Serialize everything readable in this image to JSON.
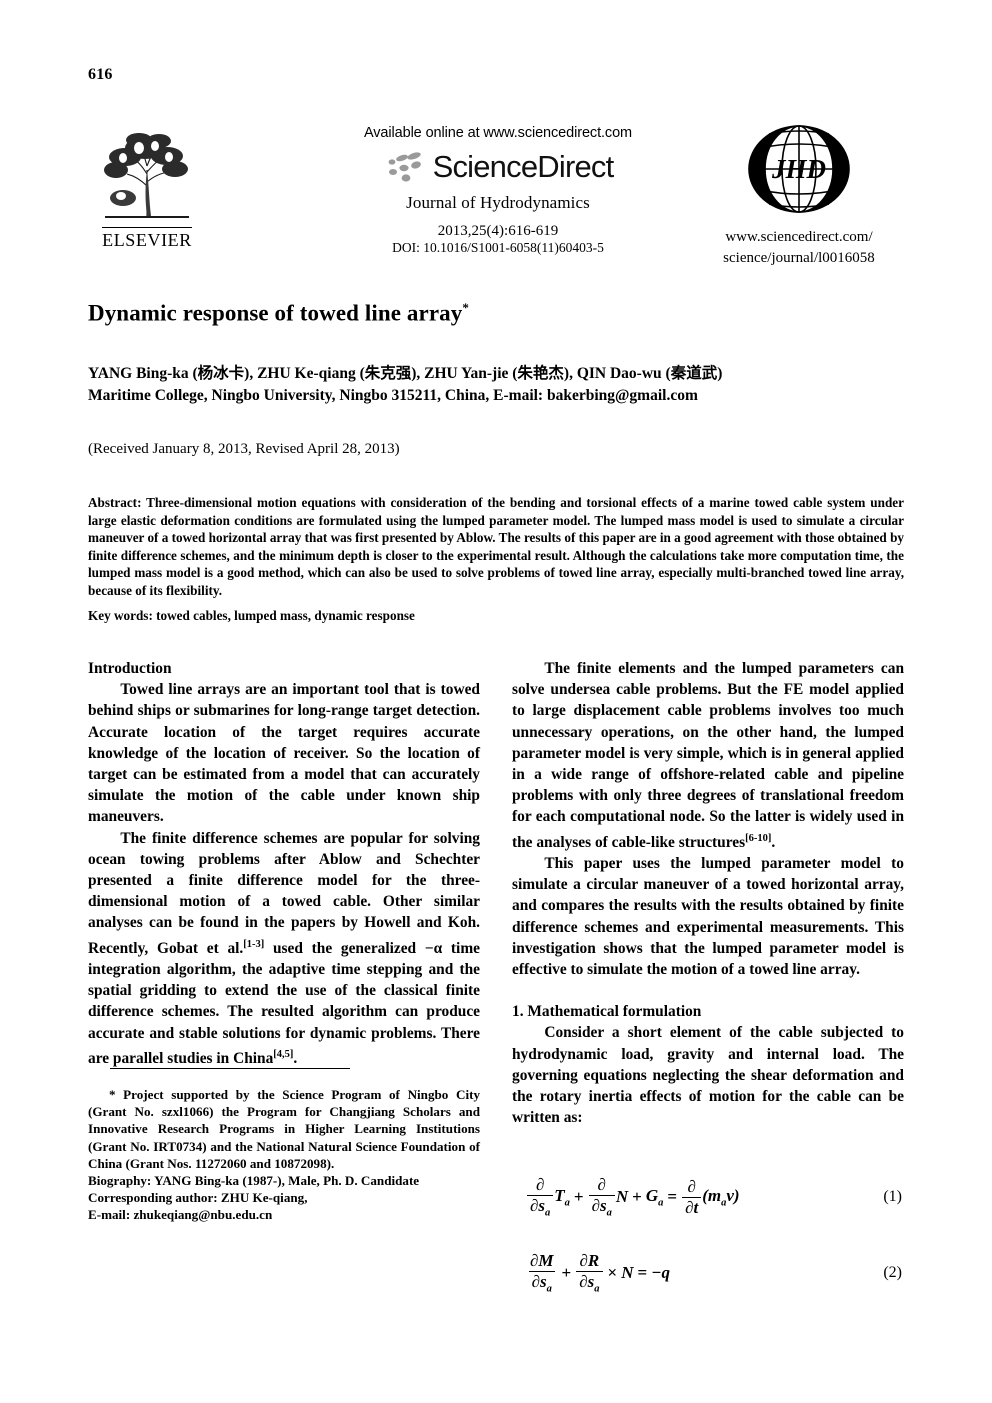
{
  "page": {
    "folio": "616"
  },
  "masthead": {
    "elsevier_label": "ELSEVIER",
    "available_online": "Available online at www.sciencedirect.com",
    "sciencedirect_wordmark": "ScienceDirect",
    "journal_name": "Journal of Hydrodynamics",
    "citation": "2013,25(4):616-619",
    "doi": "DOI: 10.1016/S1001-6058(11)60403-5",
    "jhd_monogram": "JHD",
    "jhd_url_line1": "www.sciencedirect.com/",
    "jhd_url_line2": "science/journal/l0016058"
  },
  "article": {
    "title": "Dynamic response of towed line array",
    "title_footnote_marker": "*",
    "authors": "YANG Bing-ka (杨冰卡), ZHU Ke-qiang (朱克强), ZHU Yan-jie (朱艳杰), QIN Dao-wu (秦道武)",
    "affiliation": "Maritime College, Ningbo University, Ningbo 315211, China, E-mail: bakerbing@gmail.com",
    "received": "(Received January 8, 2013, Revised April 28, 2013)"
  },
  "abstract": {
    "lead": "Abstract:",
    "text": " Three-dimensional motion equations with consideration of the bending and torsional effects of a marine towed cable system under large elastic deformation conditions are formulated using the lumped parameter model. The lumped mass model is used to simulate a circular maneuver of a towed horizontal array that was first presented by Ablow. The results of this paper are in a good agreement with those obtained by finite difference schemes, and the minimum depth is closer to the experimental result. Although the calculations take more computation time, the lumped mass model is a good method, which can also be used to solve problems of towed line array, especially multi-branched towed line array, because of its flexibility."
  },
  "keywords": {
    "lead": "Key words:",
    "text": " towed cables, lumped mass, dynamic response"
  },
  "body": {
    "left": {
      "intro_heading": "Introduction",
      "para1": "Towed line arrays are an important tool that is towed behind ships or submarines for long-range target detection. Accurate location of the target requires accurate knowledge of the location of receiver. So the location of target can be estimated from a model that can accurately simulate the motion of the cable under known ship maneuvers.",
      "para2_a": "The finite difference schemes are popular for solving ocean towing problems after Ablow and Schechter presented a finite difference model for the three-dimensional motion of a towed cable. Other similar analyses can be found in the papers by Howell and Koh. Recently, Gobat et al.",
      "para2_cite1": "[1-3]",
      "para2_b": " used the generalized −α time integration algorithm, the adaptive time stepping and the spatial gridding to extend the use of the classical finite difference schemes. The resulted algorithm can produce accurate and stable solutions for dynamic problems. There are parallel studies in China",
      "para2_cite2": "[4,5]",
      "para2_c": "."
    },
    "right": {
      "para1_a": "The finite elements and the lumped parameters can solve undersea cable problems. But the FE model applied to large displacement cable problems involves too much unnecessary operations, on the other hand, the lumped parameter model is very simple, which is in general applied in a wide range of offshore-related cable and pipeline problems with only three degrees of translational freedom for each computational node. So the latter is widely used in the analyses of cable-like structures",
      "para1_cite": "[6-10]",
      "para1_b": ".",
      "para2": "This paper uses the lumped parameter model to simulate a circular maneuver of a towed horizontal array, and compares the results with the results obtained by finite difference schemes and experimental measurements. This investigation shows that the lumped parameter model is effective to simulate the motion of a towed line array.",
      "section1_heading": "1. Mathematical formulation",
      "section1_para": "Consider a short element of the cable subjected to hydrodynamic load, gravity and internal load. The governing equations neglecting the shear deformation and the rotary inertia effects of motion for the cable can be written as:"
    }
  },
  "equations": [
    {
      "number": "(1)",
      "latex": "\\frac{\\partial}{\\partial s_a}T_a + \\frac{\\partial}{\\partial s_a}N + G_a = \\frac{\\partial}{\\partial t}(m_a v)"
    },
    {
      "number": "(2)",
      "latex": "\\frac{\\partial M}{\\partial s_a} + \\frac{\\partial R}{\\partial s_a} \\times N = -q"
    }
  ],
  "footnote": {
    "star_text": "* Project supported by the Science Program of Ningbo City (Grant No. szxl1066) the Program for Changjiang Scholars and Innovative Research Programs in Higher Learning Institutions (Grant No. IRT0734) and the National Natural Science Foundation of China (Grant Nos. 11272060 and 10872098).",
    "biography_lead": "Biography:",
    "biography_text": " YANG Bing-ka (1987-), Male, Ph. D. Candidate",
    "corresponding_lead": "Corresponding author:",
    "corresponding_text": " ZHU Ke-qiang,",
    "email_text": "E-mail: zhukeqiang@nbu.edu.cn"
  },
  "colors": {
    "ink": "#000000",
    "paper": "#ffffff"
  }
}
